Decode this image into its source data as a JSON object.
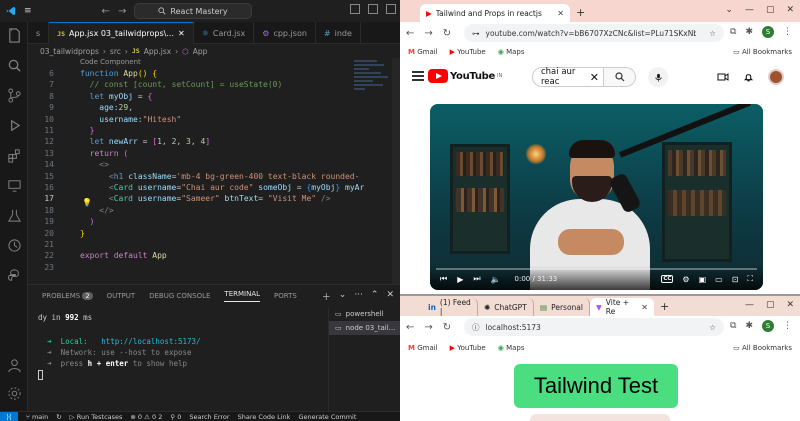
{
  "vscode": {
    "search": "React Mastery",
    "tabs": [
      {
        "label": "s",
        "badge": "",
        "active": false
      },
      {
        "label": "App.jsx 03_tailwidprops\\...",
        "badge": "JS",
        "active": true
      },
      {
        "label": "Card.jsx",
        "badge": "react",
        "active": false
      },
      {
        "label": "cpp.json",
        "badge": "cpp",
        "active": false
      },
      {
        "label": "inde",
        "badge": "hash",
        "active": false
      }
    ],
    "breadcrumb": [
      "03_tailwidprops",
      "src",
      "App.jsx",
      "App"
    ],
    "codelens": "Code Component",
    "lines": [
      {
        "n": "6",
        "html": "<span class='kw2'>function</span> <span class='fn'>App</span><span class='brk'>()</span> <span class='brk'>{</span>"
      },
      {
        "n": "7",
        "html": "  <span class='cm'>// const [count, setCount] = useState(0)</span>"
      },
      {
        "n": "8",
        "html": "  <span class='kw2'>let</span> <span class='var'>myObj</span> = <span class='brk2'>{</span>"
      },
      {
        "n": "9",
        "html": "    <span class='var'>age</span>:<span class='num'>29</span>,"
      },
      {
        "n": "10",
        "html": "    <span class='var'>username</span>:<span class='str'>\"Hitesh\"</span>"
      },
      {
        "n": "11",
        "html": "  <span class='brk2'>}</span>"
      },
      {
        "n": "12",
        "html": "  <span class='kw2'>let</span> <span class='var'>newArr</span> = <span class='brk2'>[</span><span class='num'>1</span>, <span class='num'>2</span>, <span class='num'>3</span>, <span class='num'>4</span><span class='brk2'>]</span>"
      },
      {
        "n": "13",
        "html": "  <span class='kw'>return</span> <span class='brk2'>(</span>"
      },
      {
        "n": "14",
        "html": "    <span class='punc'>&lt;&gt;</span>"
      },
      {
        "n": "15",
        "html": "      <span class='punc'>&lt;</span><span class='kw2'>h1</span> <span class='attr'>className</span>=<span class='str'>'mb-4 bg-green-400 text-black rounded-</span>"
      },
      {
        "n": "16",
        "html": "      <span class='punc'>&lt;</span><span class='tag'>Card</span> <span class='attr'>username</span>=<span class='str'>\"Chai aur code\"</span> <span class='attr'>someObj</span> = <span class='brk3'>{</span><span class='var'>myObj</span><span class='brk3'>}</span> <span class='attr'>myAr</span>"
      },
      {
        "n": "17",
        "html": "      <span class='punc'>&lt;</span><span class='tag'>Card</span> <span class='attr'>username</span>=<span class='str'>\"Sameer\"</span> <span class='attr'>btnText</span>= <span class='str'>\"Visit Me\"</span> <span class='punc'>/&gt;</span>"
      },
      {
        "n": "18",
        "html": "    <span class='punc'>&lt;/&gt;</span>"
      },
      {
        "n": "19",
        "html": "  <span class='brk2'>)</span>"
      },
      {
        "n": "20",
        "html": "<span class='brk'>}</span>"
      },
      {
        "n": "21",
        "html": ""
      },
      {
        "n": "22",
        "html": "<span class='kw'>export</span> <span class='kw'>default</span> <span class='fn'>App</span>"
      },
      {
        "n": "23",
        "html": ""
      }
    ],
    "panel": {
      "tabs": [
        "PROBLEMS",
        "OUTPUT",
        "DEBUG CONSOLE",
        "TERMINAL",
        "PORTS"
      ],
      "problems_count": "2",
      "active_tab": "TERMINAL",
      "terminal_lines": {
        "l1": "dy in ",
        "l1b": "992",
        "l1c": " ms",
        "local_label": "  ➜  Local:   ",
        "local_url": "http://localhost:5173/",
        "network": "  ➜  Network: use --host to expose",
        "help_pre": "  ➜  press ",
        "help_key": "h + enter",
        "help_post": " to show help"
      },
      "terminals": [
        "powershell",
        "node 03_tail..."
      ]
    },
    "status": {
      "branch": "main",
      "sync": "↻",
      "run": "Run Testcases",
      "problems": "⊗ 0 ⚠ 0 2",
      "ports": "⚲ 0",
      "search_error": "Search Error",
      "share": "Share Code Link",
      "generate": "Generate Commit"
    }
  },
  "chrome_youtube": {
    "tab_title": "Tailwind and Props in reactjs",
    "url": "youtube.com/watch?v=bB6707XzCNc&list=PLu71SKxNbf...",
    "bookmarks": [
      "Gmail",
      "YouTube",
      "Maps"
    ],
    "all_bookmarks": "All Bookmarks",
    "logo_text": "YouTube",
    "logo_sup": "IN",
    "search_query": "chai aur reac",
    "time": "0:00 / 31:33"
  },
  "chrome_local": {
    "tabs": [
      "(1) Feed |",
      "ChatGPT",
      "Personal",
      "Vite + Re"
    ],
    "url": "localhost:5173",
    "bookmarks": [
      "Gmail",
      "YouTube",
      "Maps"
    ],
    "all_bookmarks": "All Bookmarks",
    "heading": "Tailwind Test"
  }
}
